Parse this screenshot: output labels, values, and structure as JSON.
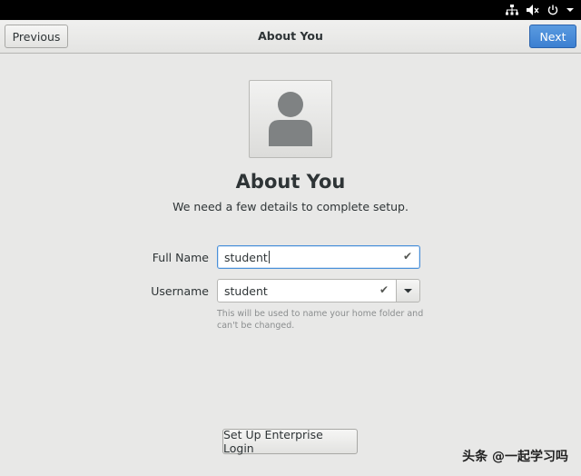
{
  "tray": {
    "icons": [
      "network-icon",
      "volume-muted-icon",
      "power-icon",
      "dropdown-arrow-icon"
    ]
  },
  "header": {
    "previous_label": "Previous",
    "title": "About You",
    "next_label": "Next"
  },
  "main": {
    "page_title": "About You",
    "subtitle": "We need a few details to complete setup.",
    "full_name_label": "Full Name",
    "full_name_value": "student",
    "username_label": "Username",
    "username_value": "student",
    "username_hint": "This will be used to name your home folder and can't be changed.",
    "enterprise_button": "Set Up Enterprise Login"
  },
  "watermark": {
    "text": "头条 @一起学习吗"
  },
  "colors": {
    "accent": "#3c7fd1",
    "background": "#e8e8e7",
    "topbar": "#000000"
  }
}
